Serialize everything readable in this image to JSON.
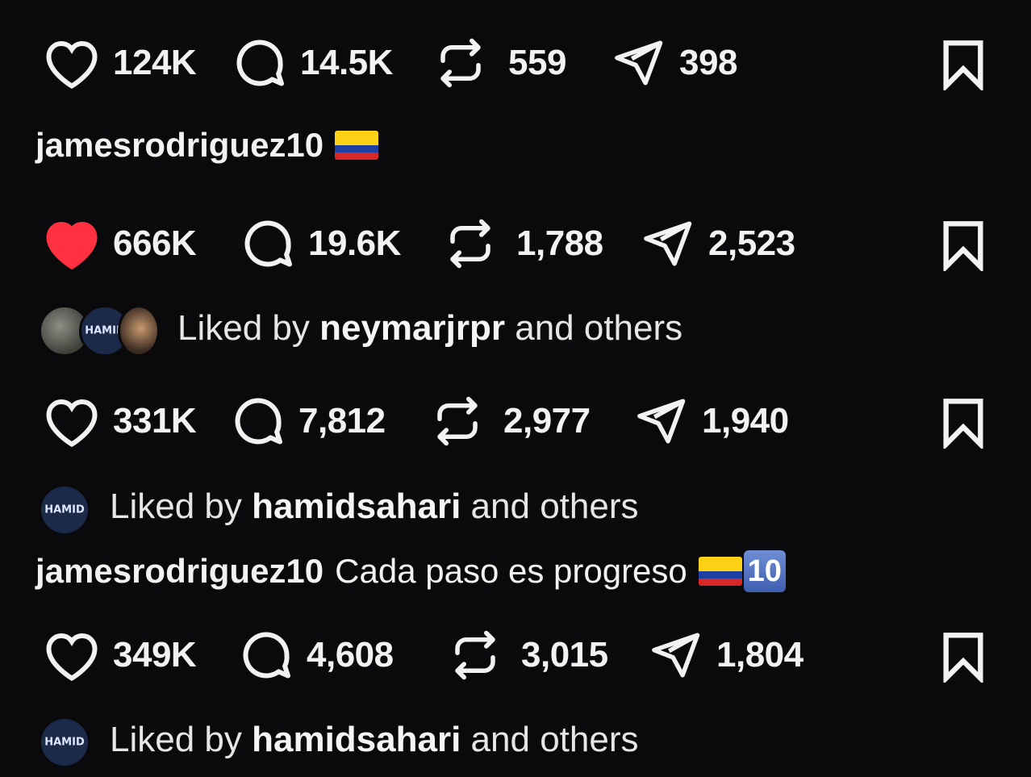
{
  "posts": [
    {
      "likes": "124K",
      "comments": "14.5K",
      "reposts": "559",
      "shares": "398",
      "liked": false,
      "caption_user": "jamesrodriguez10",
      "caption_text": ""
    },
    {
      "likes": "666K",
      "comments": "19.6K",
      "reposts": "1,788",
      "shares": "2,523",
      "liked": true,
      "liked_by_prefix": "Liked by ",
      "liked_by_user": "neymarjrpr",
      "liked_by_suffix": " and others"
    },
    {
      "likes": "331K",
      "comments": "7,812",
      "reposts": "2,977",
      "shares": "1,940",
      "liked": false,
      "liked_by_prefix": "Liked by ",
      "liked_by_user": "hamidsahari",
      "liked_by_suffix": " and others",
      "caption_user": "jamesrodriguez10",
      "caption_text": "Cada paso es progreso",
      "caption_badge": "10"
    },
    {
      "likes": "349K",
      "comments": "4,608",
      "reposts": "3,015",
      "shares": "1,804",
      "liked": false,
      "liked_by_prefix": "Liked by ",
      "liked_by_user": "hamidsahari",
      "liked_by_suffix": " and others"
    }
  ],
  "avatar_logo_text": "HAMID",
  "colors": {
    "background": "#0a0a0c",
    "text": "#f2f2f2",
    "liked_heart": "#ff3040",
    "flag_yellow": "#fcd116",
    "flag_blue": "#1d3fa3",
    "flag_red": "#d62828"
  },
  "icons": [
    "heart-icon",
    "heart-filled-icon",
    "comment-icon",
    "repost-icon",
    "share-icon",
    "bookmark-icon",
    "flag-colombia-icon",
    "keycap-10-icon"
  ]
}
